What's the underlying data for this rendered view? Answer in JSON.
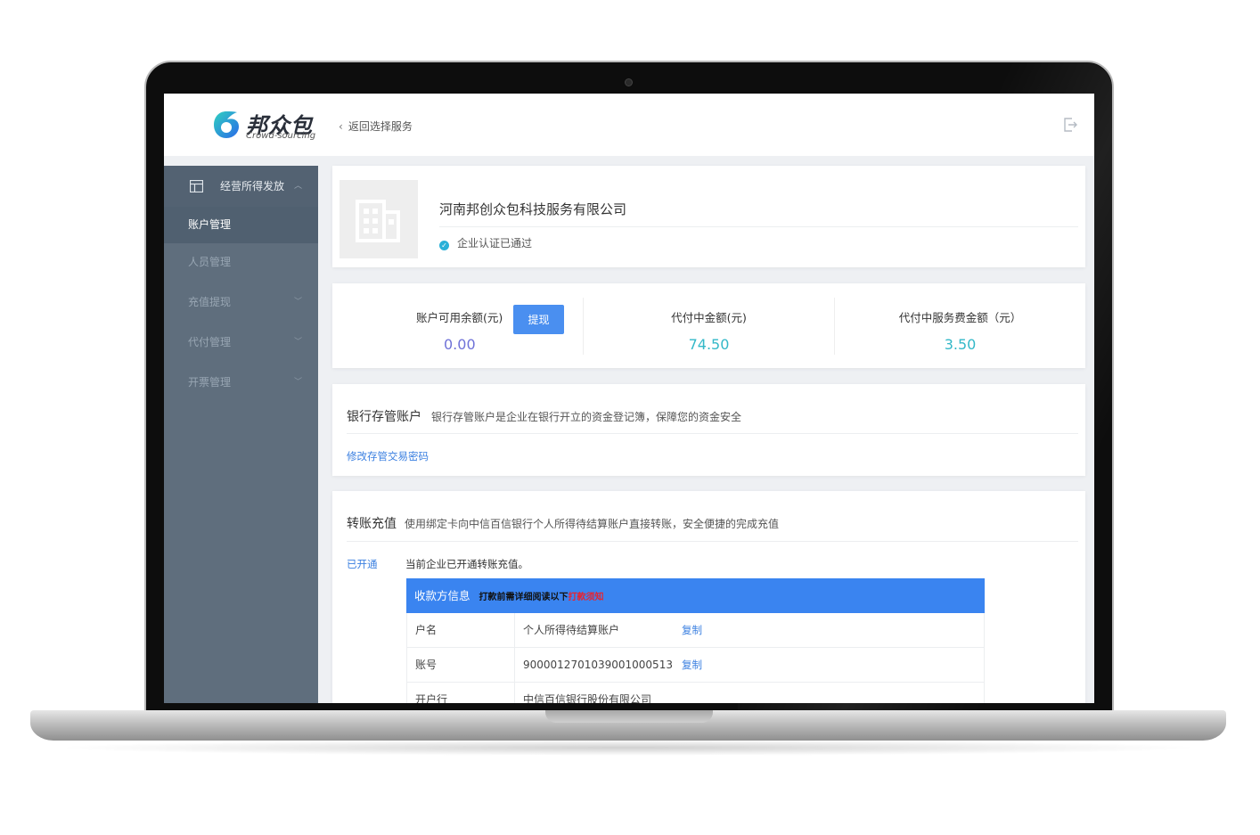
{
  "brand": {
    "name": "邦众包",
    "tagline": "Crowd-sourcing",
    "accent": "#4a8ff0"
  },
  "header": {
    "back_label": "返回选择服务",
    "logout_icon": "logout-icon"
  },
  "sidebar": {
    "group": {
      "label": "经营所得发放",
      "icon": "table-icon"
    },
    "items": [
      {
        "label": "账户管理"
      },
      {
        "label": "人员管理"
      },
      {
        "label": "充值提现"
      },
      {
        "label": "代付管理"
      },
      {
        "label": "开票管理"
      }
    ]
  },
  "company": {
    "name": "河南邦创众包科技服务有限公司",
    "verify_text": "企业认证已通过",
    "logo_icon": "building-icon"
  },
  "balance": {
    "available_label": "账户可用余额(元)",
    "available_value": "0.00",
    "withdraw_label": "提现",
    "paying_label": "代付中金额(元)",
    "paying_value": "74.50",
    "fee_label": "代付中服务费金额（元）",
    "fee_value": "3.50",
    "available_color": "#6f72d8",
    "value_color": "#33b8c8"
  },
  "bank": {
    "title": "银行存管账户",
    "desc": "银行存管账户是企业在银行开立的资金登记簿，保障您的资金安全",
    "link": "修改存管交易密码"
  },
  "transfer": {
    "title": "转账充值",
    "desc": "使用绑定卡向中信百信银行个人所得待结算账户直接转账，安全便捷的完成充值",
    "status_tag": "已开通",
    "status_text": "当前企业已开通转账充值。",
    "payee": {
      "header": "收款方信息",
      "note_prefix": "打款前需详细阅读以下",
      "note_warn": "打款须知",
      "rows": [
        {
          "key": "户名",
          "value": "个人所得待结算账户",
          "copy": "复制"
        },
        {
          "key": "账号",
          "value": "9000012701039001000513",
          "copy": "复制"
        },
        {
          "key": "开户行",
          "value": "中信百信银行股份有限公司"
        }
      ]
    }
  }
}
